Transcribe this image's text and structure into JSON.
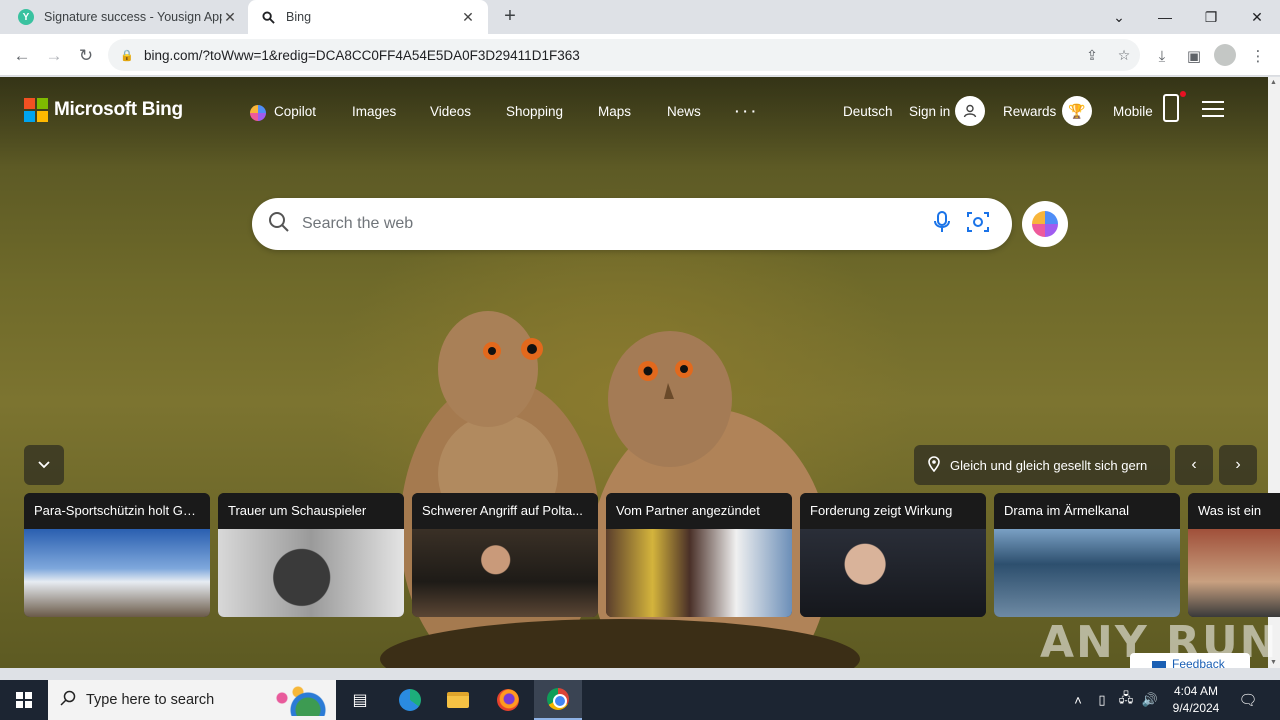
{
  "browser": {
    "tabs": [
      {
        "title": "Signature success - Yousign App",
        "favicon": "yousign-icon"
      },
      {
        "title": "Bing",
        "favicon": "search-icon"
      }
    ],
    "url": "bing.com/?toWww=1&redig=DCA8CC0FF4A54E5DA0F3D29411D1F363"
  },
  "bing": {
    "brand": "Microsoft Bing",
    "nav": [
      "Copilot",
      "Images",
      "Videos",
      "Shopping",
      "Maps",
      "News",
      "· · ·"
    ],
    "language": "Deutsch",
    "sign_in": "Sign in",
    "rewards": "Rewards",
    "mobile": "Mobile",
    "search_placeholder": "Search the web",
    "caption": "Gleich und gleich gesellt sich gern",
    "feedback": "Feedback",
    "news": [
      "Para-Sportschützin holt Go...",
      "Trauer um Schauspieler",
      "Schwerer Angriff auf Polta...",
      "Vom Partner angezündet",
      "Forderung zeigt Wirkung",
      "Drama im Ärmelkanal",
      "Was ist ein"
    ]
  },
  "watermark": "ANY RUN",
  "taskbar": {
    "search_placeholder": "Type here to search",
    "time": "4:04 AM",
    "date": "9/4/2024"
  },
  "colors": {
    "ms_red": "#f25022",
    "ms_green": "#7fba00",
    "ms_blue": "#00a4ef",
    "ms_yellow": "#ffb900"
  }
}
